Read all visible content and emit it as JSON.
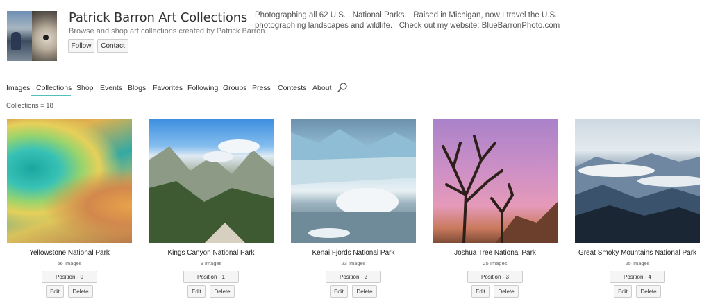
{
  "profile": {
    "title": "Patrick Barron Art Collections",
    "subtitle": "Browse and shop art collections created by Patrick Barron.",
    "follow_label": "Follow",
    "contact_label": "Contact",
    "bio": "Photographing all 62 U.S.   National Parks.   Raised in Michigan, now I travel the U.S. photographing landscapes and wildlife.   Check out my website: BlueBarronPhoto.com"
  },
  "nav": {
    "items": [
      {
        "label": "Images"
      },
      {
        "label": "Collections"
      },
      {
        "label": "Shop"
      },
      {
        "label": "Events"
      },
      {
        "label": "Blogs"
      },
      {
        "label": "Favorites"
      },
      {
        "label": "Following"
      },
      {
        "label": "Groups"
      },
      {
        "label": "Press"
      },
      {
        "label": "Contests"
      },
      {
        "label": "About"
      }
    ],
    "active": "Collections",
    "search_icon": "search-icon"
  },
  "collections_count": "Collections = 18",
  "collections": [
    {
      "title": "Yellowstone National Park",
      "count": "56 Images",
      "position": "Position - 0",
      "edit": "Edit",
      "delete": "Delete"
    },
    {
      "title": "Kings Canyon National Park",
      "count": "9 Images",
      "position": "Position - 1",
      "edit": "Edit",
      "delete": "Delete"
    },
    {
      "title": "Kenai Fjords National Park",
      "count": "23 Images",
      "position": "Position - 2",
      "edit": "Edit",
      "delete": "Delete"
    },
    {
      "title": "Joshua Tree National Park",
      "count": "25 Images",
      "position": "Position - 3",
      "edit": "Edit",
      "delete": "Delete"
    },
    {
      "title": "Great Smoky Mountains National Park",
      "count": "25 Images",
      "position": "Position - 4",
      "edit": "Edit",
      "delete": "Delete"
    }
  ],
  "colors": {
    "accent": "#4fc0c0",
    "border": "#cccccc",
    "button_bg": "#f5f5f5"
  }
}
